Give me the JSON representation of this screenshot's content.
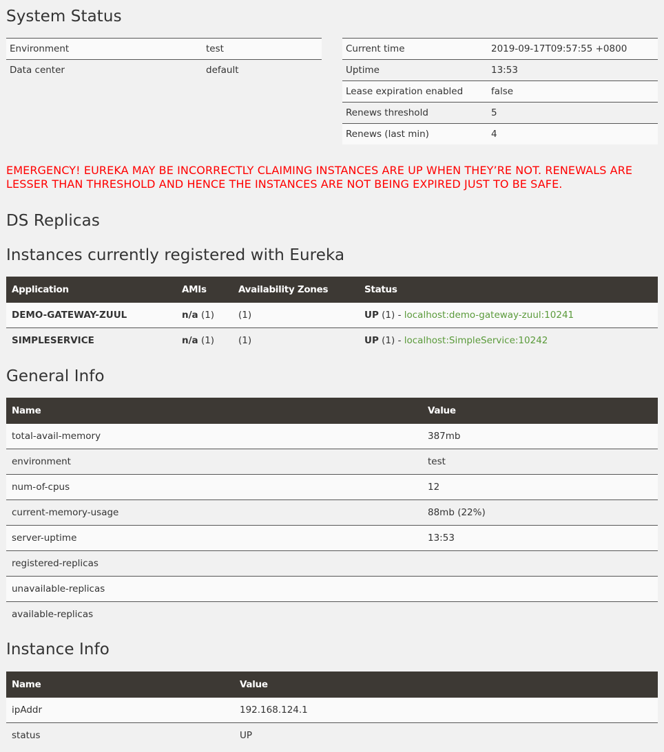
{
  "system_status": {
    "title": "System Status",
    "left": [
      {
        "key": "Environment",
        "value": "test"
      },
      {
        "key": "Data center",
        "value": "default"
      }
    ],
    "right": [
      {
        "key": "Current time",
        "value": "2019-09-17T09:57:55 +0800"
      },
      {
        "key": "Uptime",
        "value": "13:53"
      },
      {
        "key": "Lease expiration enabled",
        "value": "false"
      },
      {
        "key": "Renews threshold",
        "value": "5"
      },
      {
        "key": "Renews (last min)",
        "value": "4"
      }
    ]
  },
  "emergency": "EMERGENCY! EUREKA MAY BE INCORRECTLY CLAIMING INSTANCES ARE UP WHEN THEY’RE NOT. RENEWALS ARE LESSER THAN THRESHOLD AND HENCE THE INSTANCES ARE NOT BEING EXPIRED JUST TO BE SAFE.",
  "ds_replicas": {
    "title": "DS Replicas"
  },
  "instances": {
    "title": "Instances currently registered with Eureka",
    "headers": [
      "Application",
      "AMIs",
      "Availability Zones",
      "Status"
    ],
    "rows": [
      {
        "app": "DEMO-GATEWAY-ZUUL",
        "ami": "n/a",
        "ami_count": "(1)",
        "zones": "(1)",
        "status": "UP",
        "status_count": "(1) -",
        "link": "localhost:demo-gateway-zuul:10241"
      },
      {
        "app": "SIMPLESERVICE",
        "ami": "n/a",
        "ami_count": "(1)",
        "zones": "(1)",
        "status": "UP",
        "status_count": "(1) -",
        "link": "localhost:SimpleService:10242"
      }
    ]
  },
  "general_info": {
    "title": "General Info",
    "headers": [
      "Name",
      "Value"
    ],
    "rows": [
      {
        "name": "total-avail-memory",
        "value": "387mb"
      },
      {
        "name": "environment",
        "value": "test"
      },
      {
        "name": "num-of-cpus",
        "value": "12"
      },
      {
        "name": "current-memory-usage",
        "value": "88mb (22%)"
      },
      {
        "name": "server-uptime",
        "value": "13:53"
      },
      {
        "name": "registered-replicas",
        "value": ""
      },
      {
        "name": "unavailable-replicas",
        "value": ""
      },
      {
        "name": "available-replicas",
        "value": ""
      }
    ]
  },
  "instance_info": {
    "title": "Instance Info",
    "headers": [
      "Name",
      "Value"
    ],
    "rows": [
      {
        "name": "ipAddr",
        "value": "192.168.124.1"
      },
      {
        "name": "status",
        "value": "UP"
      }
    ]
  },
  "colors": {
    "header_bg": "#3d3934",
    "emergency": "#ff0000",
    "link": "#5a9a3a",
    "page_bg": "#f1f1f1"
  }
}
